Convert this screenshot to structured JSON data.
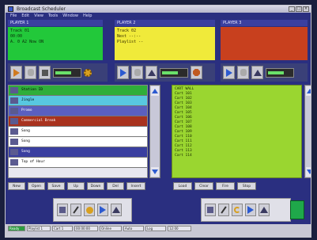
{
  "window": {
    "title": "Broadcast Scheduler"
  },
  "menu": [
    "File",
    "Edit",
    "View",
    "Tools",
    "Window",
    "Help"
  ],
  "decks": [
    {
      "header": "PLAYER 1",
      "color": "#22c83a",
      "lines": [
        "Track 01",
        "00:00",
        "A. 0 A2  Now ON"
      ]
    },
    {
      "header": "PLAYER 2",
      "color": "#f0ea3a",
      "lines": [
        "Track 02",
        "Next   --:--",
        "Playlist  --"
      ]
    },
    {
      "header": "PLAYER 3",
      "color": "#c8401e",
      "lines": [
        "",
        "",
        ""
      ]
    }
  ],
  "playlist": {
    "rows": [
      {
        "color": "#2fae3a",
        "text": "Station ID"
      },
      {
        "color": "#58c8e0",
        "text": "Jingle"
      },
      {
        "color": "#5a5fc0",
        "text": "Promo"
      },
      {
        "color": "#a8321e",
        "text": "Commercial Break"
      },
      {
        "color": "#ffffff",
        "text": "Song"
      },
      {
        "color": "#ffffff",
        "text": "Song"
      },
      {
        "color": "#3a3fa0",
        "text": "Song"
      },
      {
        "color": "#ffffff",
        "text": "Top of Hour"
      }
    ]
  },
  "cart": {
    "header": "CART WALL",
    "lines": [
      "Cart 101",
      "Cart 102",
      "Cart 103",
      "Cart 104",
      "Cart 105",
      "Cart 106",
      "Cart 107",
      "Cart 108",
      "Cart 109",
      "Cart 110",
      "Cart 111",
      "Cart 112",
      "Cart 113",
      "Cart 114"
    ]
  },
  "playlist_buttons": [
    "New",
    "Open",
    "Save",
    "Up",
    "Down",
    "Del",
    "Insert"
  ],
  "cart_buttons": [
    "Load",
    "Clear",
    "Fire",
    "Stop"
  ],
  "status": [
    "Ready",
    "Playlist 1",
    "Cart 1",
    "00:00:00",
    "Online",
    "Auto",
    "Log",
    "12:00"
  ]
}
